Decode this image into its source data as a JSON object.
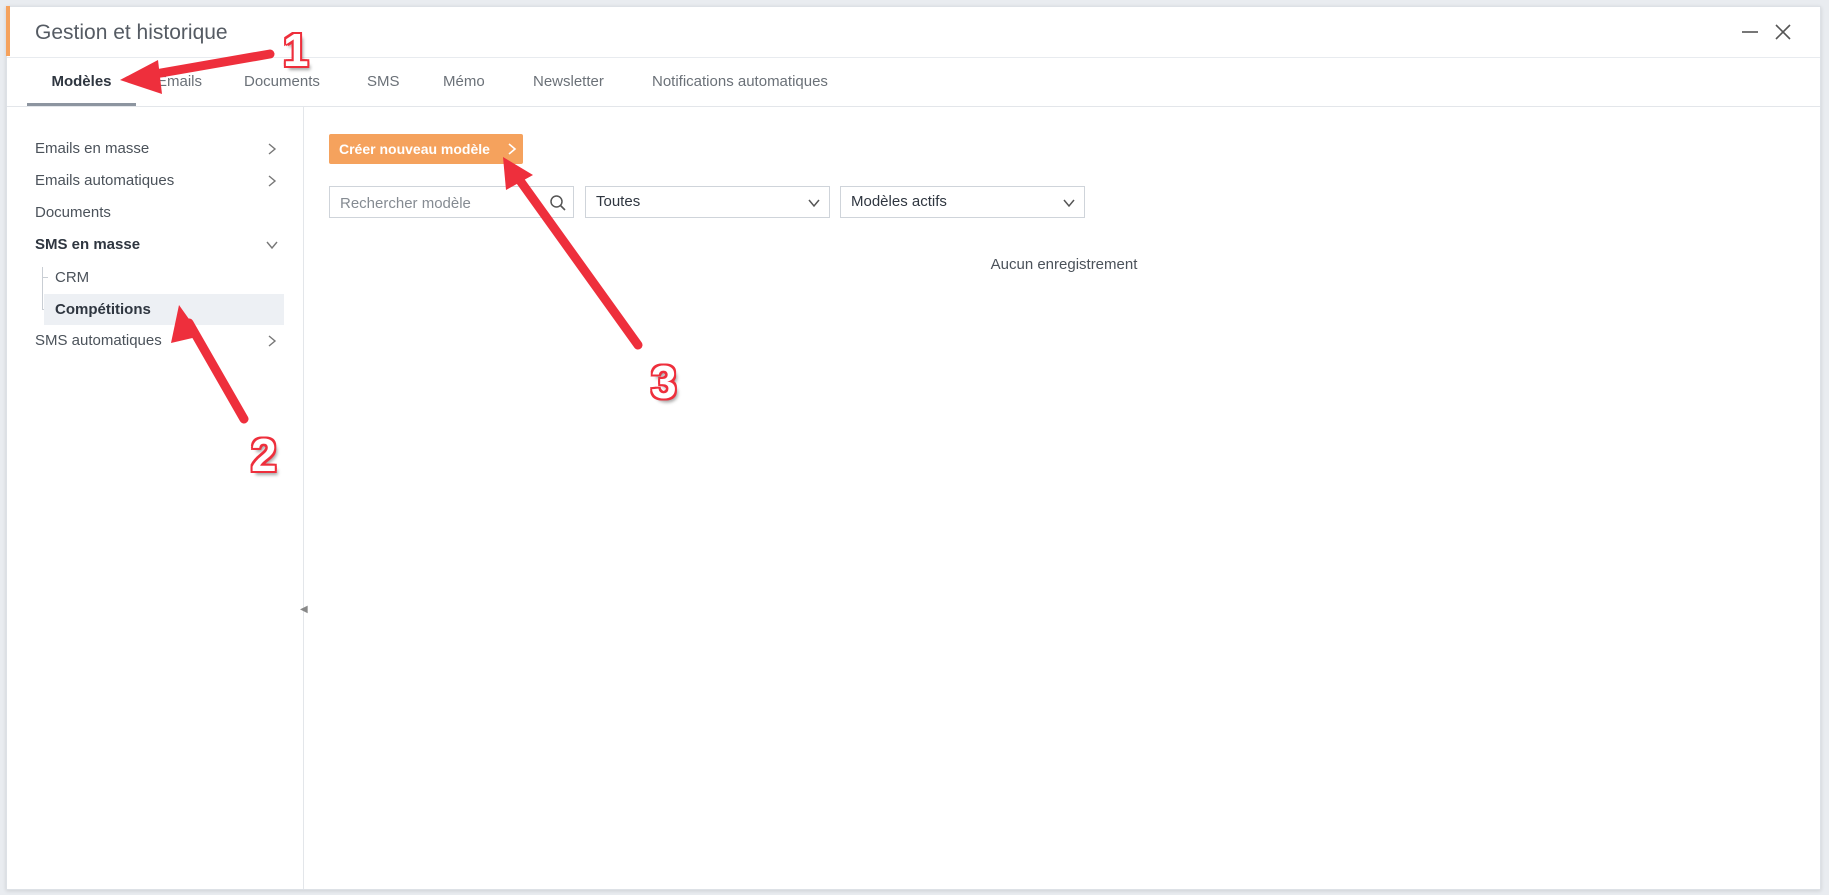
{
  "window": {
    "title": "Gestion et historique",
    "accent_color": "#f5a25d"
  },
  "tabs": [
    {
      "label": "Modèles",
      "active": true
    },
    {
      "label": "Emails"
    },
    {
      "label": "Documents"
    },
    {
      "label": "SMS"
    },
    {
      "label": "Mémo"
    },
    {
      "label": "Newsletter"
    },
    {
      "label": "Notifications automatiques"
    }
  ],
  "sidebar": {
    "items": [
      {
        "label": "Emails en masse",
        "icon": "chevron-right-icon"
      },
      {
        "label": "Emails automatiques",
        "icon": "chevron-right-icon"
      },
      {
        "label": "Documents"
      },
      {
        "label": "SMS en masse",
        "icon": "chevron-down-icon",
        "expanded": true,
        "children": [
          {
            "label": "CRM"
          },
          {
            "label": "Compétitions",
            "selected": true
          }
        ]
      },
      {
        "label": "SMS automatiques",
        "icon": "chevron-right-icon"
      }
    ]
  },
  "toolbar": {
    "create_label": "Créer nouveau modèle",
    "search_placeholder": "Rechercher modèle",
    "filter_category": "Toutes",
    "filter_status": "Modèles actifs"
  },
  "content": {
    "empty_message": "Aucun enregistrement"
  },
  "annotations": {
    "color": "#ee2f3c",
    "markers": [
      "1",
      "2",
      "3"
    ]
  }
}
